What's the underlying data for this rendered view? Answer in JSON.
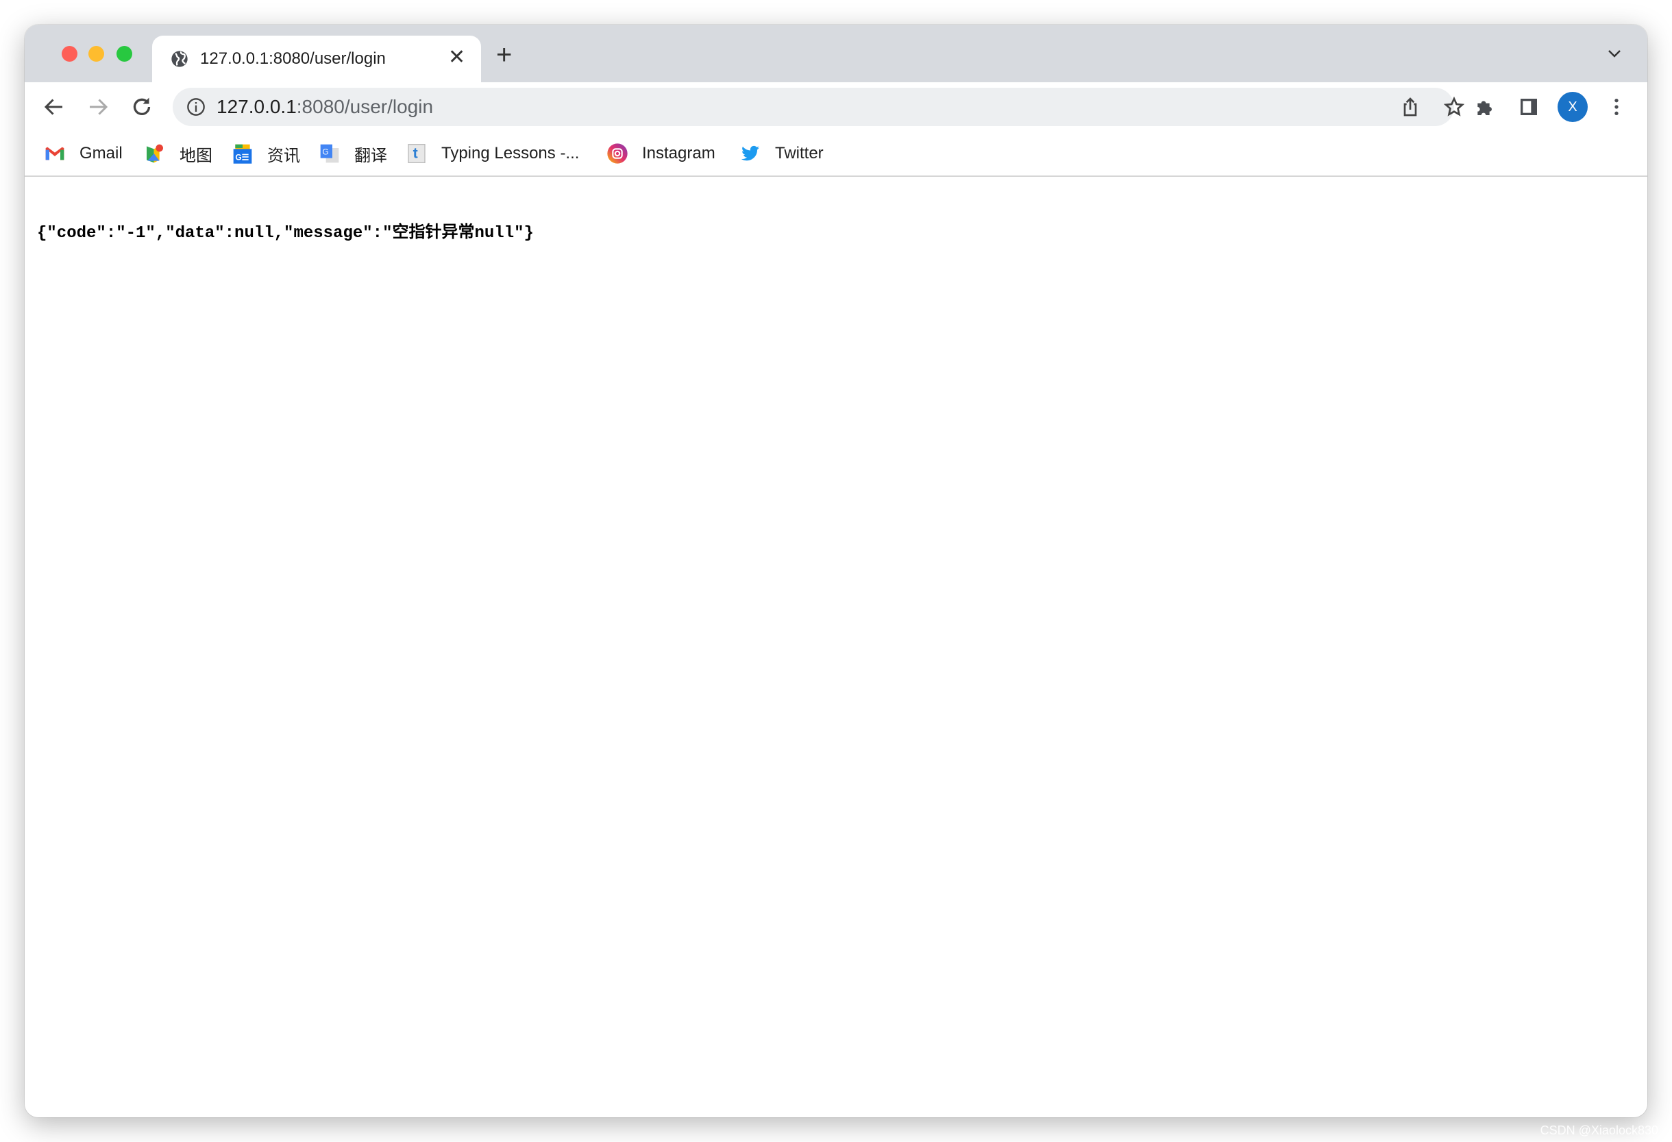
{
  "tab": {
    "title": "127.0.0.1:8080/user/login",
    "close_icon": "close-icon",
    "new_tab_icon": "plus-icon"
  },
  "omnibox": {
    "url_host": "127.0.0.1",
    "url_rest": ":8080/user/login"
  },
  "bookmarks": [
    {
      "label": "Gmail",
      "icon": "gmail-icon"
    },
    {
      "label": "地图",
      "icon": "google-maps-icon"
    },
    {
      "label": "资讯",
      "icon": "google-news-icon"
    },
    {
      "label": "翻译",
      "icon": "google-translate-icon"
    },
    {
      "label": "Typing Lessons -...",
      "icon": "typing-t-icon"
    },
    {
      "label": "Instagram",
      "icon": "instagram-icon"
    },
    {
      "label": "Twitter",
      "icon": "twitter-icon"
    }
  ],
  "profile": {
    "initial": "X",
    "color": "#1a73c8"
  },
  "page": {
    "body": "{\"code\":\"-1\",\"data\":null,\"message\":\"空指针异常null\"}"
  },
  "watermark": "CSDN @Xiaolock830"
}
